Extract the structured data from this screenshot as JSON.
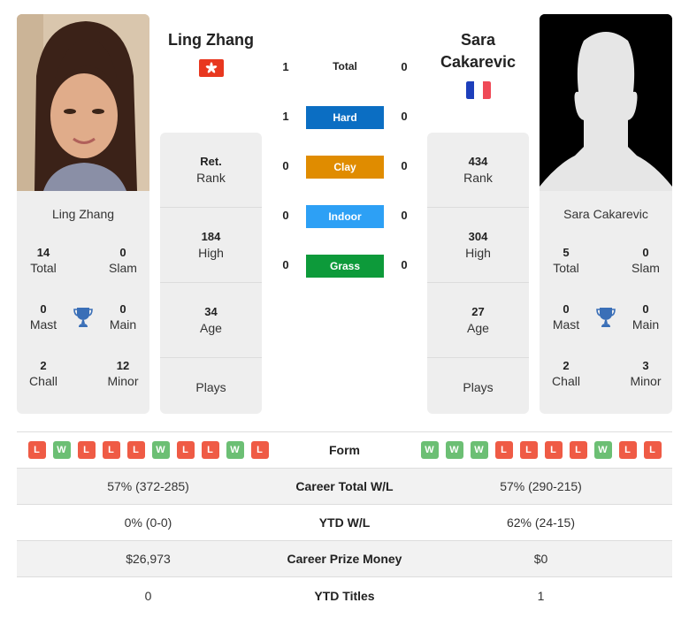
{
  "colors": {
    "hard": "#0b6ec3",
    "clay": "#e08c00",
    "indoor": "#2da0f5",
    "grass": "#0d9a3a",
    "win": "#6cbf74",
    "loss": "#ef5b45",
    "trophy": "#3a6fb7"
  },
  "player1": {
    "name": "Ling Zhang",
    "flag_icon": "hong-kong-flag-icon",
    "card_name": "Ling Zhang",
    "titles": {
      "total": {
        "value": "14",
        "label": "Total"
      },
      "slam": {
        "value": "0",
        "label": "Slam"
      },
      "mast": {
        "value": "0",
        "label": "Mast"
      },
      "main": {
        "value": "0",
        "label": "Main"
      },
      "chall": {
        "value": "2",
        "label": "Chall"
      },
      "minor": {
        "value": "12",
        "label": "Minor"
      }
    },
    "info": {
      "rank": {
        "value": "Ret.",
        "label": "Rank"
      },
      "high": {
        "value": "184",
        "label": "High"
      },
      "age": {
        "value": "34",
        "label": "Age"
      },
      "plays": {
        "value": "",
        "label": "Plays"
      }
    },
    "form": [
      "L",
      "W",
      "L",
      "L",
      "L",
      "W",
      "L",
      "L",
      "W",
      "L"
    ],
    "career_wl": "57% (372-285)",
    "ytd_wl": "0% (0-0)",
    "prize_money": "$26,973",
    "ytd_titles": "0"
  },
  "player2": {
    "name": "Sara Cakarevic",
    "flag_icon": "france-flag-icon",
    "card_name": "Sara Cakarevic",
    "titles": {
      "total": {
        "value": "5",
        "label": "Total"
      },
      "slam": {
        "value": "0",
        "label": "Slam"
      },
      "mast": {
        "value": "0",
        "label": "Mast"
      },
      "main": {
        "value": "0",
        "label": "Main"
      },
      "chall": {
        "value": "2",
        "label": "Chall"
      },
      "minor": {
        "value": "3",
        "label": "Minor"
      }
    },
    "info": {
      "rank": {
        "value": "434",
        "label": "Rank"
      },
      "high": {
        "value": "304",
        "label": "High"
      },
      "age": {
        "value": "27",
        "label": "Age"
      },
      "plays": {
        "value": "",
        "label": "Plays"
      }
    },
    "form": [
      "W",
      "W",
      "W",
      "L",
      "L",
      "L",
      "L",
      "W",
      "L",
      "L"
    ],
    "career_wl": "57% (290-215)",
    "ytd_wl": "62% (24-15)",
    "prize_money": "$0",
    "ytd_titles": "1"
  },
  "h2h": {
    "total": {
      "label": "Total",
      "p1": "1",
      "p2": "0"
    },
    "hard": {
      "label": "Hard",
      "p1": "1",
      "p2": "0"
    },
    "clay": {
      "label": "Clay",
      "p1": "0",
      "p2": "0"
    },
    "indoor": {
      "label": "Indoor",
      "p1": "0",
      "p2": "0"
    },
    "grass": {
      "label": "Grass",
      "p1": "0",
      "p2": "0"
    }
  },
  "table": {
    "form_label": "Form",
    "career_wl_label": "Career Total W/L",
    "ytd_wl_label": "YTD W/L",
    "prize_label": "Career Prize Money",
    "ytd_titles_label": "YTD Titles"
  }
}
